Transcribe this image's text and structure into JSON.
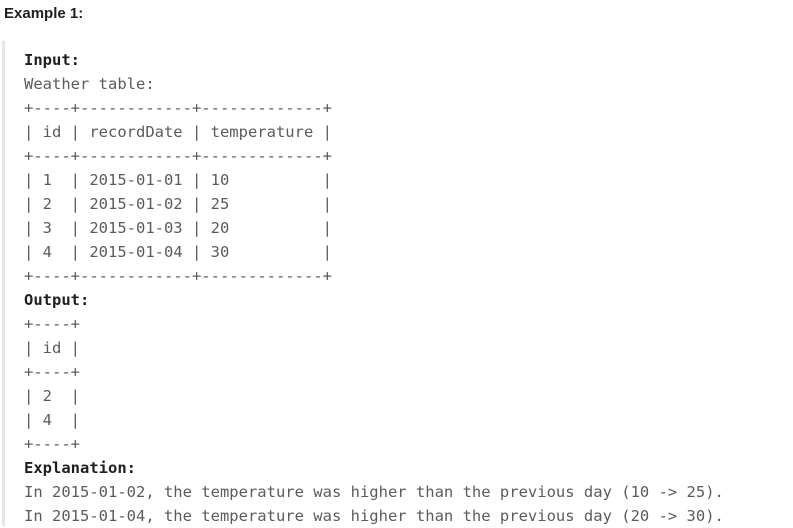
{
  "example": {
    "heading": "Example 1:",
    "input_label": "Input:",
    "input_lines": [
      "Weather table:",
      "+----+------------+-------------+",
      "| id | recordDate | temperature |",
      "+----+------------+-------------+",
      "| 1  | 2015-01-01 | 10          |",
      "| 2  | 2015-01-02 | 25          |",
      "| 3  | 2015-01-03 | 20          |",
      "| 4  | 2015-01-04 | 30          |",
      "+----+------------+-------------+"
    ],
    "output_label": "Output:",
    "output_lines": [
      "+----+",
      "| id |",
      "+----+",
      "| 2  |",
      "| 4  |",
      "+----+"
    ],
    "explanation_label": "Explanation:",
    "explanation_lines": [
      "In 2015-01-02, the temperature was higher than the previous day (10 -> 25).",
      "In 2015-01-04, the temperature was higher than the previous day (20 -> 30)."
    ]
  }
}
